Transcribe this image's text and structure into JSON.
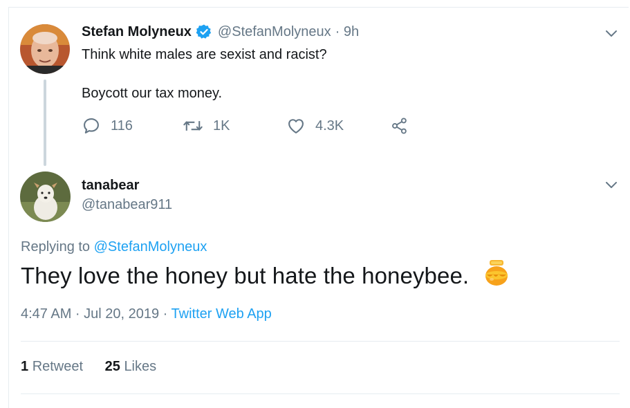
{
  "original_tweet": {
    "name": "Stefan Molyneux",
    "handle": "@StefanMolyneux",
    "time": "· 9h",
    "text_line1": "Think white males are sexist and racist?",
    "text_line2": "Boycott our tax money.",
    "replies": "116",
    "retweets": "1K",
    "likes": "4.3K"
  },
  "reply_tweet": {
    "name": "tanabear",
    "handle": "@tanabear911",
    "replying_prefix": "Replying to",
    "replying_to": "@StefanMolyneux",
    "text": "They love the honey but hate the honeybee.",
    "timestamp": "4:47 AM · Jul 20, 2019 ·",
    "source": "Twitter Web App",
    "retweet_count": "1",
    "retweet_label": "Retweet",
    "like_count": "25",
    "like_label": "Likes"
  },
  "colors": {
    "accent": "#1da1f2",
    "secondary_text": "#657786",
    "divider": "#e6ecf0"
  },
  "icons": [
    "verified-badge-icon",
    "chevron-down-icon",
    "reply-icon",
    "retweet-icon",
    "like-icon",
    "share-icon",
    "honey-pot-emoji-icon"
  ]
}
